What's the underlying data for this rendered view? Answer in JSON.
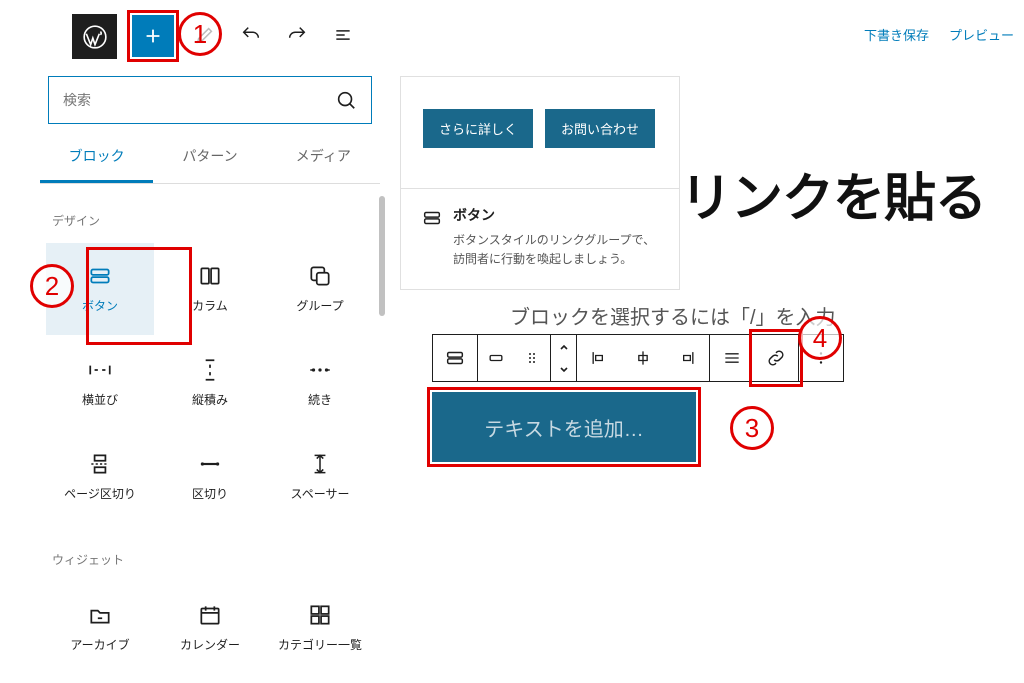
{
  "top": {
    "saveDraft": "下書き保存",
    "preview": "プレビュー"
  },
  "inserter": {
    "searchPlaceholder": "検索",
    "tabs": {
      "blocks": "ブロック",
      "patterns": "パターン",
      "media": "メディア"
    },
    "categories": {
      "design": "デザイン",
      "widgets": "ウィジェット"
    },
    "blocks": {
      "buttons": "ボタン",
      "columns": "カラム",
      "group": "グループ",
      "row": "横並び",
      "stack": "縦積み",
      "more": "続き",
      "pageBreak": "ページ区切り",
      "separator": "区切り",
      "spacer": "スペーサー",
      "archive": "アーカイブ",
      "calendar": "カレンダー",
      "categories": "カテゴリー一覧"
    }
  },
  "previewCard": {
    "btn1": "さらに詳しく",
    "btn2": "お問い合わせ",
    "title": "ボタン",
    "desc": "ボタンスタイルのリンクグループで、訪問者に行動を喚起しましょう。"
  },
  "editor": {
    "titleFragment": "リンクを貼る",
    "helper": "ブロックを選択するには「/」を入力",
    "buttonPlaceholder": "テキストを追加…"
  },
  "annotations": {
    "n1": "1",
    "n2": "2",
    "n3": "3",
    "n4": "4"
  }
}
